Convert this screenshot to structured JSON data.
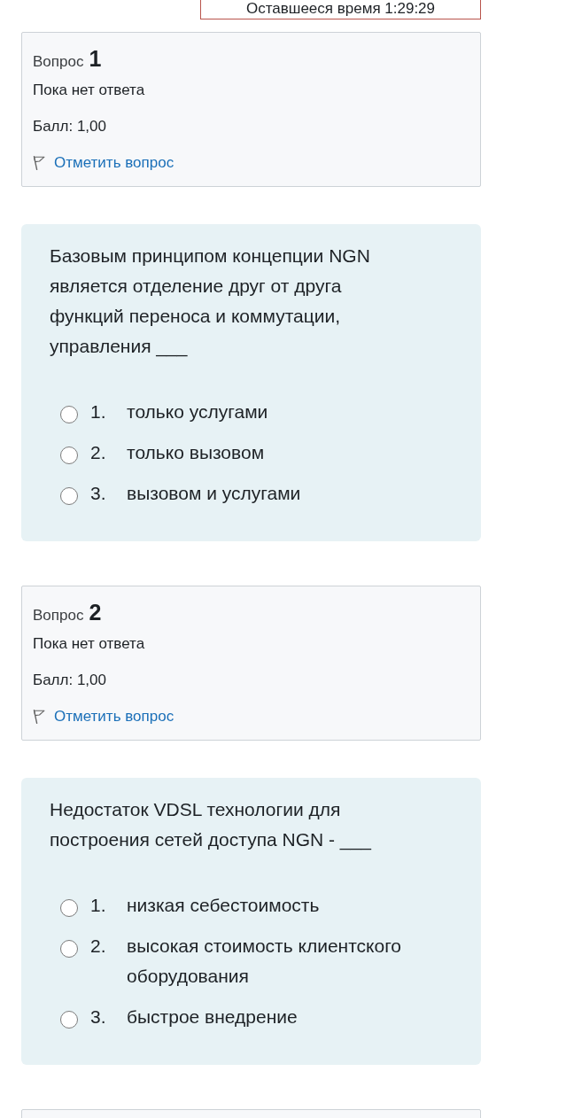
{
  "timer": {
    "label": "Оставшееся время 1:29:29"
  },
  "questions": [
    {
      "label": "Вопрос",
      "number": "1",
      "status": "Пока нет ответа",
      "grade": "Балл: 1,00",
      "flag_link": "Отметить вопрос",
      "flagged": false,
      "text": "Базовым принципом концепции NGN является отделение друг от друга функций переноса и коммутации, управления ___",
      "answers": [
        {
          "number": "1.",
          "text": "только услугами",
          "selected": false
        },
        {
          "number": "2.",
          "text": "только вызовом",
          "selected": false
        },
        {
          "number": "3.",
          "text": "вызовом и услугами",
          "selected": false
        }
      ]
    },
    {
      "label": "Вопрос",
      "number": "2",
      "status": "Пока нет ответа",
      "grade": "Балл: 1,00",
      "flag_link": "Отметить вопрос",
      "flagged": false,
      "text": "Недостаток VDSL технологии для построения сетей доступа NGN - ___",
      "answers": [
        {
          "number": "1.",
          "text": "низкая себестоимость",
          "selected": false
        },
        {
          "number": "2.",
          "text": "высокая стоимость клиентского оборудования",
          "selected": false
        },
        {
          "number": "3.",
          "text": "быстрое внедрение",
          "selected": false
        }
      ]
    }
  ]
}
